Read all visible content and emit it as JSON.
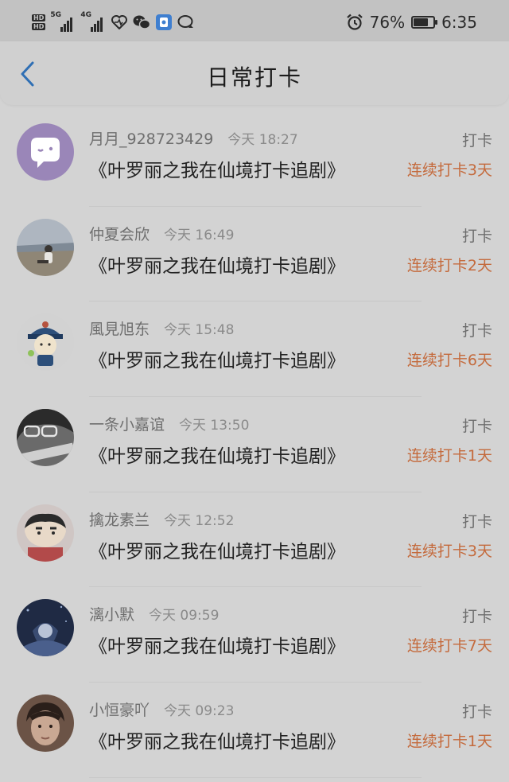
{
  "status_bar": {
    "network_1": "5G",
    "network_2": "4G",
    "hd_1": "HD",
    "hd_2": "HD",
    "battery_percent": "76%",
    "battery_level": 0.76,
    "time": "6:35",
    "icons": [
      "heart-pulse-icon",
      "wechat-icon",
      "app-icon",
      "message-icon",
      "alarm-icon"
    ]
  },
  "header": {
    "title": "日常打卡",
    "back_icon": "chevron-left-icon"
  },
  "colors": {
    "accent": "#c46a3c",
    "back": "#2f6fb4"
  },
  "checkins": [
    {
      "username": "月月_928723429",
      "time": "今天 18:27",
      "action": "打卡",
      "show": "《叶罗丽之我在仙境打卡追剧》",
      "streak": "连续打卡3天",
      "avatar": "wink-avatar"
    },
    {
      "username": "仲夏会欣",
      "time": "今天 16:49",
      "action": "打卡",
      "show": "《叶罗丽之我在仙境打卡追剧》",
      "streak": "连续打卡2天",
      "avatar": "beach-avatar"
    },
    {
      "username": "風見旭东",
      "time": "今天 15:48",
      "action": "打卡",
      "show": "《叶罗丽之我在仙境打卡追剧》",
      "streak": "连续打卡6天",
      "avatar": "cartoon-avatar"
    },
    {
      "username": "一条小嘉谊",
      "time": "今天 13:50",
      "action": "打卡",
      "show": "《叶罗丽之我在仙境打卡追剧》",
      "streak": "连续打卡1天",
      "avatar": "glasses-avatar"
    },
    {
      "username": "擒龙素兰",
      "time": "今天 12:52",
      "action": "打卡",
      "show": "《叶罗丽之我在仙境打卡追剧》",
      "streak": "连续打卡3天",
      "avatar": "crayon-avatar"
    },
    {
      "username": "漓小默",
      "time": "今天 09:59",
      "action": "打卡",
      "show": "《叶罗丽之我在仙境打卡追剧》",
      "streak": "连续打卡7天",
      "avatar": "night-avatar"
    },
    {
      "username": "小恒豪吖",
      "time": "今天 09:23",
      "action": "打卡",
      "show": "《叶罗丽之我在仙境打卡追剧》",
      "streak": "连续打卡1天",
      "avatar": "portrait-avatar"
    }
  ]
}
